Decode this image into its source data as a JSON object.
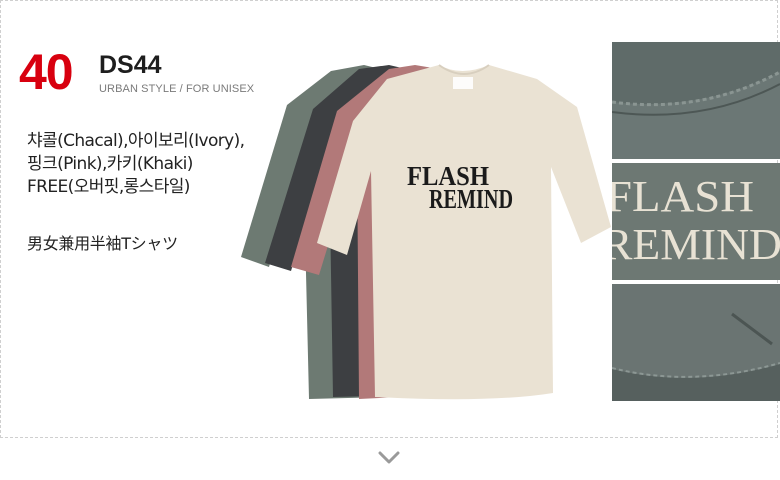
{
  "product": {
    "number": "40",
    "code": "DS44",
    "subtitle": "URBAN STYLE / FOR UNISEX",
    "colors_line1": "챠콜(Chacal),아이보리(Ivory),",
    "colors_line2": "핑크(Pink),카키(Khaki)",
    "size_line": "FREE(오버핏,롱스타일)",
    "jp_name": "男女兼用半袖Tシャツ",
    "print_line1": "FLASH",
    "print_line2": "REMIND",
    "detail_print_line1": "FLASH",
    "detail_print_line2": "REMIND"
  },
  "colors": {
    "accent": "#d8000f",
    "khaki": "#6d7a72",
    "charcoal": "#3d3f42",
    "pink": "#b27979",
    "ivory": "#eae2d3"
  },
  "icons": {
    "arrow": "chevron-down-icon"
  }
}
